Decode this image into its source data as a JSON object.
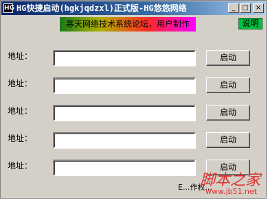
{
  "window": {
    "title": "HG快捷启动(hgkjqdzxl)正式版-HG悠悠网络",
    "icon": "HG",
    "buttons": {
      "minimize": "_",
      "maximize": "□",
      "close": "×"
    }
  },
  "banner": "寒天网络技术系统论坛，用户制作",
  "help_button": "说明",
  "rows": [
    {
      "label": "地址：",
      "value": "",
      "button": "启动"
    },
    {
      "label": "地址：",
      "value": "",
      "button": "启动"
    },
    {
      "label": "地址：",
      "value": "",
      "button": "启动"
    },
    {
      "label": "地址：",
      "value": "",
      "button": "启动"
    },
    {
      "label": "地址：",
      "value": "",
      "button": "启动"
    }
  ],
  "status_text": "E...作权...",
  "watermark": {
    "main": "脚本之家",
    "url": "www.jb51.net"
  }
}
